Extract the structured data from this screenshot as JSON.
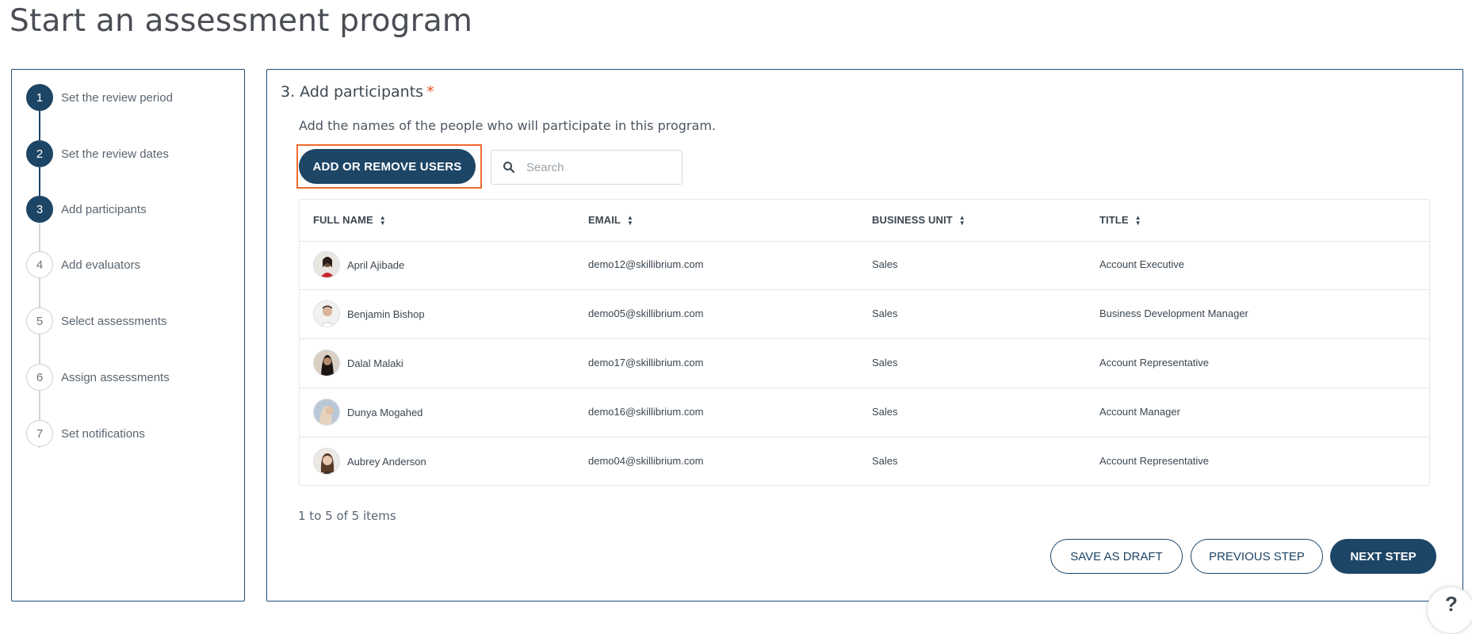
{
  "page": {
    "title": "Start an assessment program"
  },
  "steps": [
    {
      "number": "1",
      "label": "Set the review period",
      "state": "done"
    },
    {
      "number": "2",
      "label": "Set the review dates",
      "state": "done"
    },
    {
      "number": "3",
      "label": "Add participants",
      "state": "current"
    },
    {
      "number": "4",
      "label": "Add evaluators",
      "state": "todo"
    },
    {
      "number": "5",
      "label": "Select assessments",
      "state": "todo"
    },
    {
      "number": "6",
      "label": "Assign assessments",
      "state": "todo"
    },
    {
      "number": "7",
      "label": "Set notifications",
      "state": "todo"
    }
  ],
  "section": {
    "title": "3. Add participants",
    "required_mark": "*",
    "description": "Add the names of the people who will participate in this program."
  },
  "toolbar": {
    "add_remove_label": "ADD OR REMOVE USERS",
    "search_placeholder": "Search",
    "search_icon": "search-icon"
  },
  "table": {
    "headers": [
      "FULL NAME",
      "EMAIL",
      "BUSINESS UNIT",
      "TITLE"
    ],
    "rows": [
      {
        "name": "April Ajibade",
        "email": "demo12@skillibrium.com",
        "unit": "Sales",
        "title": "Account Executive"
      },
      {
        "name": "Benjamin Bishop",
        "email": "demo05@skillibrium.com",
        "unit": "Sales",
        "title": "Business Development Manager"
      },
      {
        "name": "Dalal Malaki",
        "email": "demo17@skillibrium.com",
        "unit": "Sales",
        "title": "Account Representative"
      },
      {
        "name": "Dunya Mogahed",
        "email": "demo16@skillibrium.com",
        "unit": "Sales",
        "title": "Account Manager"
      },
      {
        "name": "Aubrey Anderson",
        "email": "demo04@skillibrium.com",
        "unit": "Sales",
        "title": "Account Representative"
      }
    ]
  },
  "pager": {
    "text": "1 to 5 of 5 items"
  },
  "actions": {
    "save_draft": "SAVE AS DRAFT",
    "previous": "PREVIOUS STEP",
    "next": "NEXT STEP"
  },
  "help": {
    "label": "?"
  },
  "colors": {
    "primary": "#1d4566",
    "highlight": "#f06a2d",
    "required": "#e8542a"
  }
}
